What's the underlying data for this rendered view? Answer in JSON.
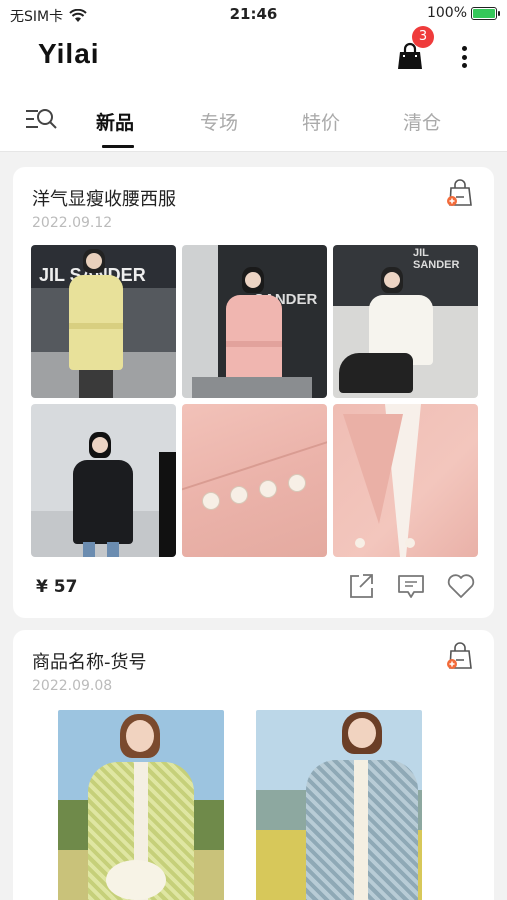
{
  "status_bar": {
    "carrier": "无SIM卡",
    "time": "21:46",
    "battery": "100%"
  },
  "header": {
    "logo": "Yilai",
    "cart_badge": "3"
  },
  "tabs": [
    {
      "label": "新品",
      "active": true
    },
    {
      "label": "专场",
      "active": false
    },
    {
      "label": "特价",
      "active": false
    },
    {
      "label": "清仓",
      "active": false
    }
  ],
  "posts": [
    {
      "title": "洋气显瘦收腰西服",
      "date": "2022.09.12",
      "price": "¥ 57",
      "images": [
        "yellow-blazer-photo",
        "pink-blazer-photo",
        "white-blazer-photo",
        "black-blazer-photo",
        "pink-sleeve-button-detail",
        "pink-lapel-detail"
      ]
    },
    {
      "title": "商品名称-货号",
      "date": "2022.09.08",
      "images": [
        "green-cardigan-photo",
        "blue-cardigan-photo"
      ]
    }
  ]
}
